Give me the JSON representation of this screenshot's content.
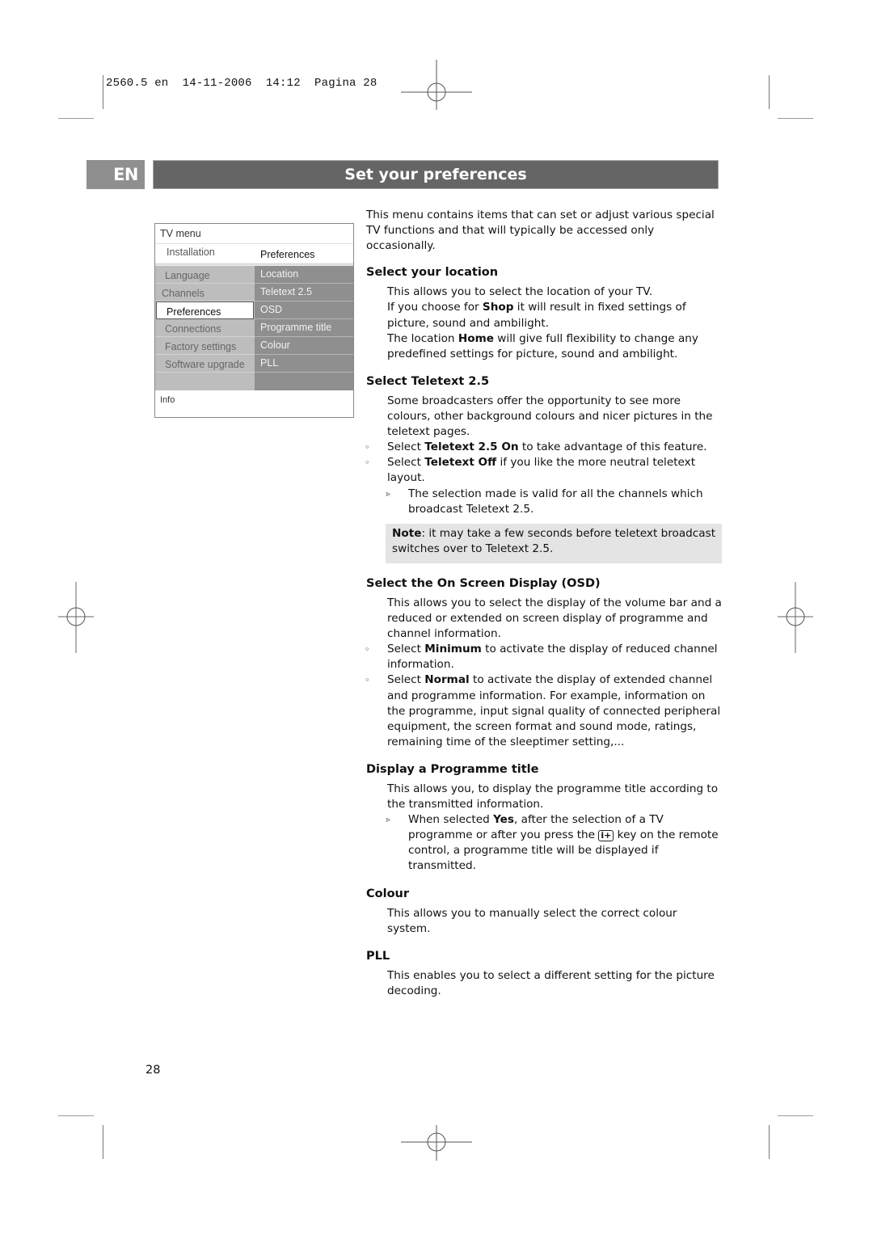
{
  "slug": {
    "text": "2560.5 en  14-11-2006  14:12  Pagina 28"
  },
  "header": {
    "language_badge": "EN",
    "title": "Set your preferences"
  },
  "tv_menu": {
    "title": "TV menu",
    "left_header": "Installation",
    "right_header": "Preferences",
    "left_items": [
      {
        "label": "Language",
        "selected": false
      },
      {
        "label": "Channels",
        "selected": false
      },
      {
        "label": "Preferences",
        "selected": true
      },
      {
        "label": "Connections",
        "selected": false
      },
      {
        "label": "Factory settings",
        "selected": false
      },
      {
        "label": "Software upgrade",
        "selected": false
      }
    ],
    "right_items": [
      "Location",
      "Teletext 2.5",
      "OSD",
      "Programme title",
      "Colour",
      "PLL"
    ],
    "info_label": "Info",
    "colors": {
      "left_panel": "#bdbdbd",
      "right_panel": "#8f8f8f"
    }
  },
  "intro": "This menu contains items that can set or adjust various special TV functions and that will typically be accessed only occasionally.",
  "sections": {
    "location": {
      "heading": "Select your location",
      "p1": "This allows you to select the location of your TV.",
      "p2_pre": "If you choose for ",
      "p2_bold": "Shop",
      "p2_post": " it will result in fixed settings of picture, sound and ambilight.",
      "p3_pre": "The location ",
      "p3_bold": "Home",
      "p3_post": " will give full flexibility to change any predefined settings for picture, sound and ambilight."
    },
    "teletext": {
      "heading": "Select Teletext 2.5",
      "p1": "Some broadcasters offer the opportunity to see more colours, other background colours and nicer pictures in the teletext pages.",
      "b1_pre": "Select ",
      "b1_bold": "Teletext 2.5 On",
      "b1_post": " to take advantage of this feature.",
      "b2_pre": "Select ",
      "b2_bold": "Teletext Off",
      "b2_post": " if you like the more neutral teletext layout.",
      "sub1": "The selection made is valid for all the channels which broadcast Teletext 2.5.",
      "note_bold": "Note",
      "note_text": ": it may take a few seconds before teletext broadcast switches over to Teletext 2.5."
    },
    "osd": {
      "heading": "Select the On Screen Display (OSD)",
      "p1": "This allows you to select the display of the volume bar and a reduced or extended on screen display of programme and channel information.",
      "b1_pre": "Select ",
      "b1_bold": "Minimum",
      "b1_post": " to activate the display of reduced channel information.",
      "b2_pre": "Select ",
      "b2_bold": "Normal",
      "b2_post": " to activate the display of extended channel and programme information. For example, information on the programme, input signal quality of connected peripheral equipment, the screen format and sound mode, ratings, remaining time of the sleeptimer setting,..."
    },
    "programme_title": {
      "heading": "Display a Programme title",
      "p1": "This allows you, to display the programme title according to the transmitted information.",
      "sub1_pre": "When selected ",
      "sub1_bold": "Yes",
      "sub1_mid": ", after the selection of a TV programme or after you press the ",
      "sub1_key": "i+",
      "sub1_post": " key on the remote control, a  programme title will be displayed if transmitted."
    },
    "colour": {
      "heading": "Colour",
      "p1": "This allows you to manually select the correct colour system."
    },
    "pll": {
      "heading": "PLL",
      "p1": "This enables you to select a different setting for the picture decoding."
    }
  },
  "markers": {
    "bullet": "◦",
    "sub_bullet": "▹"
  },
  "page_number": "28",
  "colors": {
    "title_bar": "#656565",
    "language_badge": "#8f8f8f",
    "note_background": "#e4e4e4"
  }
}
